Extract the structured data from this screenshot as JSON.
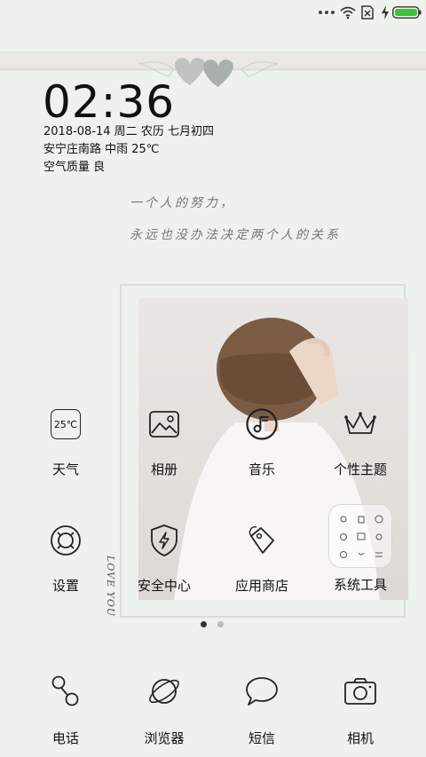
{
  "status": {
    "icons": [
      "dots-icon",
      "wifi-icon",
      "sim-off-icon",
      "charging-icon",
      "battery-icon"
    ],
    "battery_color": "#3fbf3f"
  },
  "clock": {
    "time": "02:36"
  },
  "info": {
    "date_line": "2018-08-14 周二 农历 七月初四",
    "weather_line": "安宁庄南路 中雨 25℃",
    "air_line": "空气质量 良"
  },
  "quote": {
    "line1": "一个人的努力，",
    "line2": "永远也没办法决定两个人的关系"
  },
  "wallpaper": {
    "side_text": "LOVE YOU"
  },
  "apps_row1": [
    {
      "label": "天气",
      "icon": "weather-25c-icon",
      "icon_text": "25℃"
    },
    {
      "label": "相册",
      "icon": "gallery-icon"
    },
    {
      "label": "音乐",
      "icon": "music-icon"
    },
    {
      "label": "个性主题",
      "icon": "crown-theme-icon"
    }
  ],
  "apps_row2": [
    {
      "label": "设置",
      "icon": "settings-icon"
    },
    {
      "label": "安全中心",
      "icon": "security-shield-icon"
    },
    {
      "label": "应用商店",
      "icon": "app-store-tag-icon"
    },
    {
      "label": "系统工具",
      "icon": "system-tools-folder-icon"
    }
  ],
  "page_indicator": {
    "count": 2,
    "active": 0
  },
  "dock": [
    {
      "label": "电话",
      "icon": "phone-icon"
    },
    {
      "label": "浏览器",
      "icon": "browser-planet-icon"
    },
    {
      "label": "短信",
      "icon": "message-bubble-icon"
    },
    {
      "label": "相机",
      "icon": "camera-icon"
    }
  ]
}
